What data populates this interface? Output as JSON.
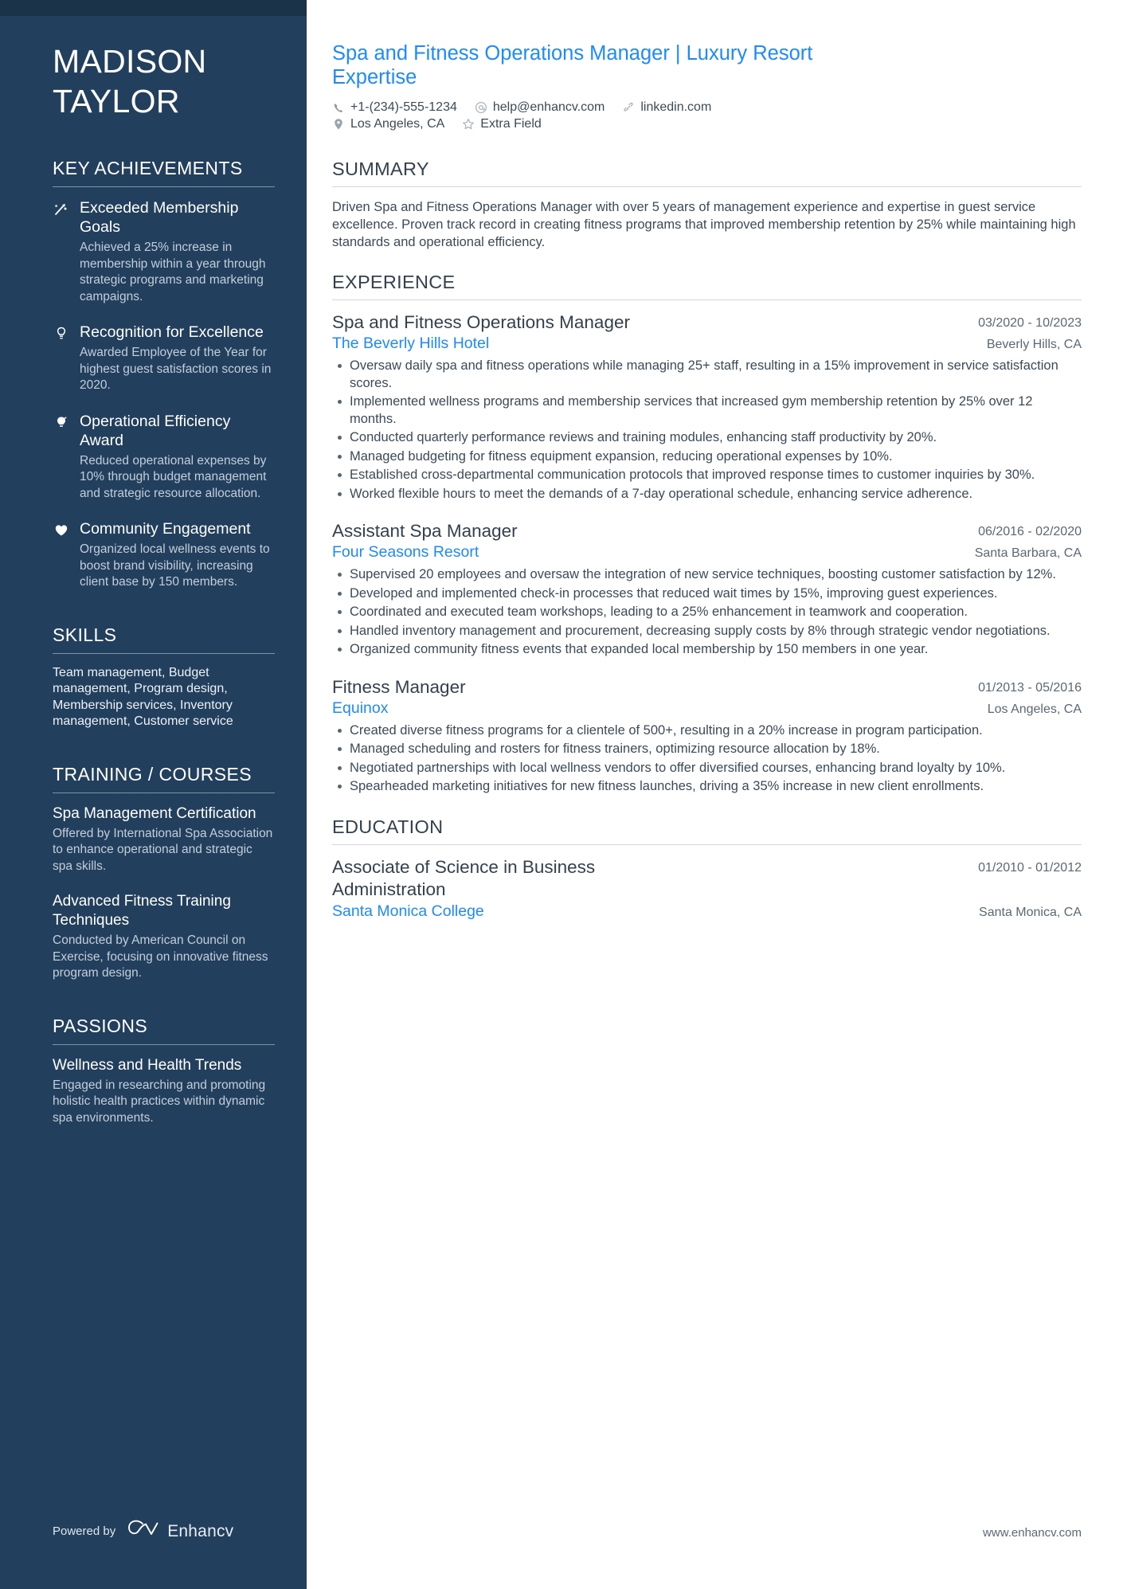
{
  "colors": {
    "sidebar_bg": "#22405e",
    "sidebar_top": "#1b3349",
    "accent_blue": "#1a8cff",
    "body_text": "#3b4a59",
    "heading_text": "#33414f"
  },
  "sidebar": {
    "name_first": "MADISON",
    "name_last": "TAYLOR",
    "key_achievements": {
      "heading": "KEY ACHIEVEMENTS",
      "items": [
        {
          "icon": "rocket-trend-icon",
          "title": "Exceeded Membership Goals",
          "description": "Achieved a 25% increase in membership within a year through strategic programs and marketing campaigns."
        },
        {
          "icon": "lightbulb-outline-icon",
          "title": "Recognition for Excellence",
          "description": "Awarded Employee of the Year for highest guest satisfaction scores in 2020."
        },
        {
          "icon": "lightbulb-filled-icon",
          "title": "Operational Efficiency Award",
          "description": "Reduced operational expenses by 10% through budget management and strategic resource allocation."
        },
        {
          "icon": "heart-icon",
          "title": "Community Engagement",
          "description": "Organized local wellness events to boost brand visibility, increasing client base by 150 members."
        }
      ]
    },
    "skills": {
      "heading": "SKILLS",
      "text": "Team management, Budget management, Program design, Membership services, Inventory management, Customer service"
    },
    "training": {
      "heading": "TRAINING / COURSES",
      "items": [
        {
          "title": "Spa Management Certification",
          "description": "Offered by International Spa Association to enhance operational and strategic spa skills."
        },
        {
          "title": "Advanced Fitness Training Techniques",
          "description": "Conducted by American Council on Exercise, focusing on innovative fitness program design."
        }
      ]
    },
    "passions": {
      "heading": "PASSIONS",
      "items": [
        {
          "title": "Wellness and Health Trends",
          "description": "Engaged in researching and promoting holistic health practices within dynamic spa environments."
        }
      ]
    },
    "powered_by": {
      "label": "Powered by",
      "brand": "Enhancv",
      "logo_icon": "enhancv-logo-icon"
    }
  },
  "main": {
    "headline": "Spa and Fitness Operations Manager | Luxury Resort Expertise",
    "contact_row_1": [
      {
        "icon": "phone-icon",
        "value": "+1-(234)-555-1234"
      },
      {
        "icon": "at-email-icon",
        "value": "help@enhancv.com"
      },
      {
        "icon": "link-icon",
        "value": "linkedin.com"
      }
    ],
    "contact_row_2": [
      {
        "icon": "location-pin-icon",
        "value": "Los Angeles, CA"
      },
      {
        "icon": "star-icon",
        "value": "Extra Field"
      }
    ],
    "summary": {
      "heading": "SUMMARY",
      "text": "Driven Spa and Fitness Operations Manager with over 5 years of management experience and expertise in guest service excellence. Proven track record in creating fitness programs that improved membership retention by 25% while maintaining high standards and operational efficiency."
    },
    "experience": {
      "heading": "EXPERIENCE",
      "jobs": [
        {
          "title": "Spa and Fitness Operations Manager",
          "date": "03/2020 - 10/2023",
          "company": "The Beverly Hills Hotel",
          "location": "Beverly Hills, CA",
          "bullets": [
            "Oversaw daily spa and fitness operations while managing 25+ staff, resulting in a 15% improvement in service satisfaction scores.",
            "Implemented wellness programs and membership services that increased gym membership retention by 25% over 12 months.",
            "Conducted quarterly performance reviews and training modules, enhancing staff productivity by 20%.",
            "Managed budgeting for fitness equipment expansion, reducing operational expenses by 10%.",
            "Established cross-departmental communication protocols that improved response times to customer inquiries by 30%.",
            "Worked flexible hours to meet the demands of a 7-day operational schedule, enhancing service adherence."
          ]
        },
        {
          "title": "Assistant Spa Manager",
          "date": "06/2016 - 02/2020",
          "company": "Four Seasons Resort",
          "location": "Santa Barbara, CA",
          "bullets": [
            "Supervised 20 employees and oversaw the integration of new service techniques, boosting customer satisfaction by 12%.",
            "Developed and implemented check-in processes that reduced wait times by 15%, improving guest experiences.",
            "Coordinated and executed team workshops, leading to a 25% enhancement in teamwork and cooperation.",
            "Handled inventory management and procurement, decreasing supply costs by 8% through strategic vendor negotiations.",
            "Organized community fitness events that expanded local membership by 150 members in one year."
          ]
        },
        {
          "title": "Fitness Manager",
          "date": "01/2013 - 05/2016",
          "company": "Equinox",
          "location": "Los Angeles, CA",
          "bullets": [
            "Created diverse fitness programs for a clientele of 500+, resulting in a 20% increase in program participation.",
            "Managed scheduling and rosters for fitness trainers, optimizing resource allocation by 18%.",
            "Negotiated partnerships with local wellness vendors to offer diversified courses, enhancing brand loyalty by 10%.",
            "Spearheaded marketing initiatives for new fitness launches, driving a 35% increase in new client enrollments."
          ]
        }
      ]
    },
    "education": {
      "heading": "EDUCATION",
      "items": [
        {
          "title": "Associate of Science in Business Administration",
          "date": "01/2010 - 01/2012",
          "school": "Santa Monica College",
          "location": "Santa Monica, CA"
        }
      ]
    },
    "site_footer": "www.enhancv.com"
  }
}
